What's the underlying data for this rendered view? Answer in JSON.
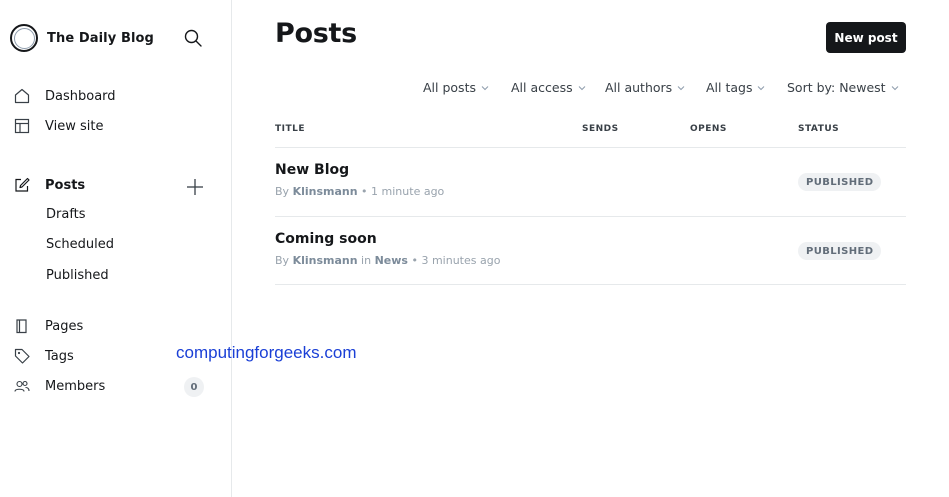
{
  "sidebar": {
    "site_title": "The Daily Blog",
    "nav": {
      "dashboard": "Dashboard",
      "view_site": "View site",
      "posts": "Posts",
      "drafts": "Drafts",
      "scheduled": "Scheduled",
      "published": "Published",
      "pages": "Pages",
      "tags": "Tags",
      "members": "Members",
      "members_count": "0"
    }
  },
  "main": {
    "title": "Posts",
    "new_post_label": "New post",
    "filters": {
      "all_posts": "All posts",
      "all_access": "All access",
      "all_authors": "All authors",
      "all_tags": "All tags",
      "sort": "Sort by: Newest"
    },
    "columns": {
      "title": "TITLE",
      "sends": "SENDS",
      "opens": "OPENS",
      "status": "STATUS"
    },
    "posts": [
      {
        "title": "New Blog",
        "by": "By",
        "author": "Klinsmann",
        "time": " • 1 minute ago",
        "status": "PUBLISHED"
      },
      {
        "title": "Coming soon",
        "by": "By",
        "author": "Klinsmann",
        "in": " in ",
        "tag": "News",
        "time": " • 3 minutes ago",
        "status": "PUBLISHED"
      }
    ]
  },
  "watermark": "computingforgeeks.com",
  "colors": {
    "primary_button": "#15171a",
    "badge_bg": "#eff1f3",
    "watermark": "#1a3fd6"
  }
}
